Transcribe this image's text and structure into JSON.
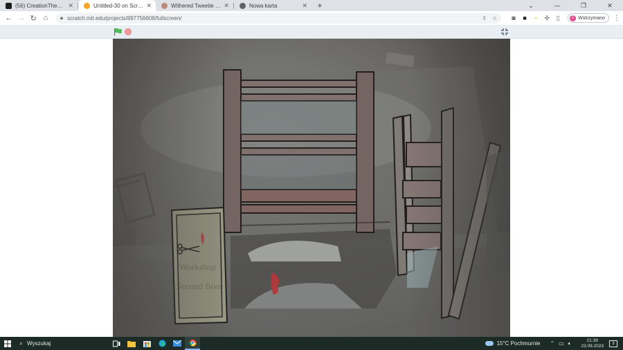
{
  "browser": {
    "tabs": [
      {
        "title": "(56) CreationTheDev (@MasterT...",
        "favicon_color": "#1d1d1b",
        "active": false
      },
      {
        "title": "Untitled-30 on Scratch",
        "favicon_color": "#f6a623",
        "active": true
      },
      {
        "title": "Withered Tweetie | JOLLY Wiki |...",
        "favicon_color": "#c08a7a",
        "active": false
      },
      {
        "title": "Nowa karta",
        "favicon_color": "#5f6368",
        "active": false
      }
    ],
    "new_tab": "+",
    "url": "scratch.mit.edu/projects/897756608/fullscreen/",
    "profile_initial": "Z",
    "profile_label": "Wstrzymano"
  },
  "scratch": {
    "flag_color": "#4cbf56",
    "stop_color": "#ec9c9c"
  },
  "stage": {
    "sign_line1": "Workshop",
    "sign_line2": "Second floor"
  },
  "taskbar": {
    "search_placeholder": "Wyszukaj",
    "weather": "15°C  Pochmurnie",
    "time": "21:39",
    "date": "23.09.2023"
  }
}
